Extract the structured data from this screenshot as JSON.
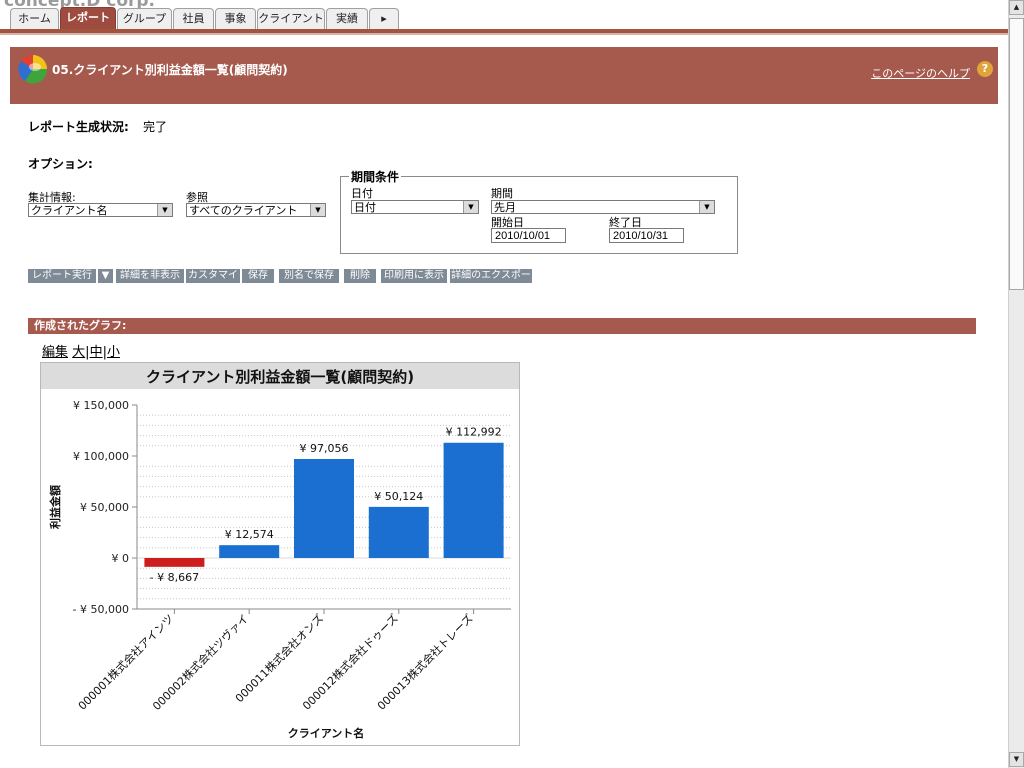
{
  "app": {
    "brand": "concept.D corp."
  },
  "tabs": [
    {
      "label": "ホーム",
      "active": false
    },
    {
      "label": "レポート",
      "active": true
    },
    {
      "label": "グループ",
      "active": false
    },
    {
      "label": "社員",
      "active": false
    },
    {
      "label": "事象",
      "active": false
    },
    {
      "label": "クライアント",
      "active": false
    },
    {
      "label": "実績",
      "active": false
    },
    {
      "label": "▸",
      "active": false
    }
  ],
  "header": {
    "title": "05.クライアント別利益金額一覧(顧問契約)",
    "help_link": "このページのヘルプ",
    "help_icon": "?"
  },
  "status": {
    "label": "レポート生成状況:",
    "value": "完了"
  },
  "options": {
    "label": "オプション:",
    "aggregate_label": "集計情報:",
    "aggregate_value": "クライアント名",
    "reference_label": "参照",
    "reference_value": "すべてのクライアント"
  },
  "period": {
    "legend": "期間条件",
    "date_label": "日付",
    "date_value": "日付",
    "range_label": "期間",
    "range_value": "先月",
    "start_label": "開始日",
    "start_value": "2010/10/01",
    "end_label": "終了日",
    "end_value": "2010/10/31"
  },
  "buttons": {
    "run": "レポート実行",
    "hide_details": "詳細を非表示",
    "customize": "カスタマイズ",
    "save": "保存",
    "save_as": "別名で保存",
    "delete": "削除",
    "print": "印刷用に表示",
    "export": "詳細のエクスポート"
  },
  "graph_section": {
    "title": "作成されたグラフ:",
    "edit": "編集",
    "large": "大",
    "medium": "中",
    "small": "小"
  },
  "colors": {
    "header": "#a65a4e",
    "bar_positive": "#1a6fd0",
    "bar_negative": "#cc1e1e"
  },
  "chart_data": {
    "type": "bar",
    "title": "クライアント別利益金額一覧(顧問契約)",
    "xlabel": "クライアント名",
    "ylabel": "利益金額",
    "categories": [
      "000001株式会社アインツ",
      "000002株式会社ツヴァイ",
      "000011株式会社オンズ",
      "000012株式会社ドゥーズ",
      "000013株式会社トレーズ"
    ],
    "values": [
      -8667,
      12574,
      97056,
      50124,
      112992
    ],
    "value_labels": [
      "- ¥ 8,667",
      "¥ 12,574",
      "¥ 97,056",
      "¥ 50,124",
      "¥ 112,992"
    ],
    "ylim": [
      -50000,
      150000
    ],
    "yticks": [
      150000,
      100000,
      50000,
      0,
      -50000
    ],
    "ytick_labels": [
      "¥ 150,000",
      "¥ 100,000",
      "¥ 50,000",
      "¥ 0",
      "- ¥ 50,000"
    ],
    "grid": true
  }
}
